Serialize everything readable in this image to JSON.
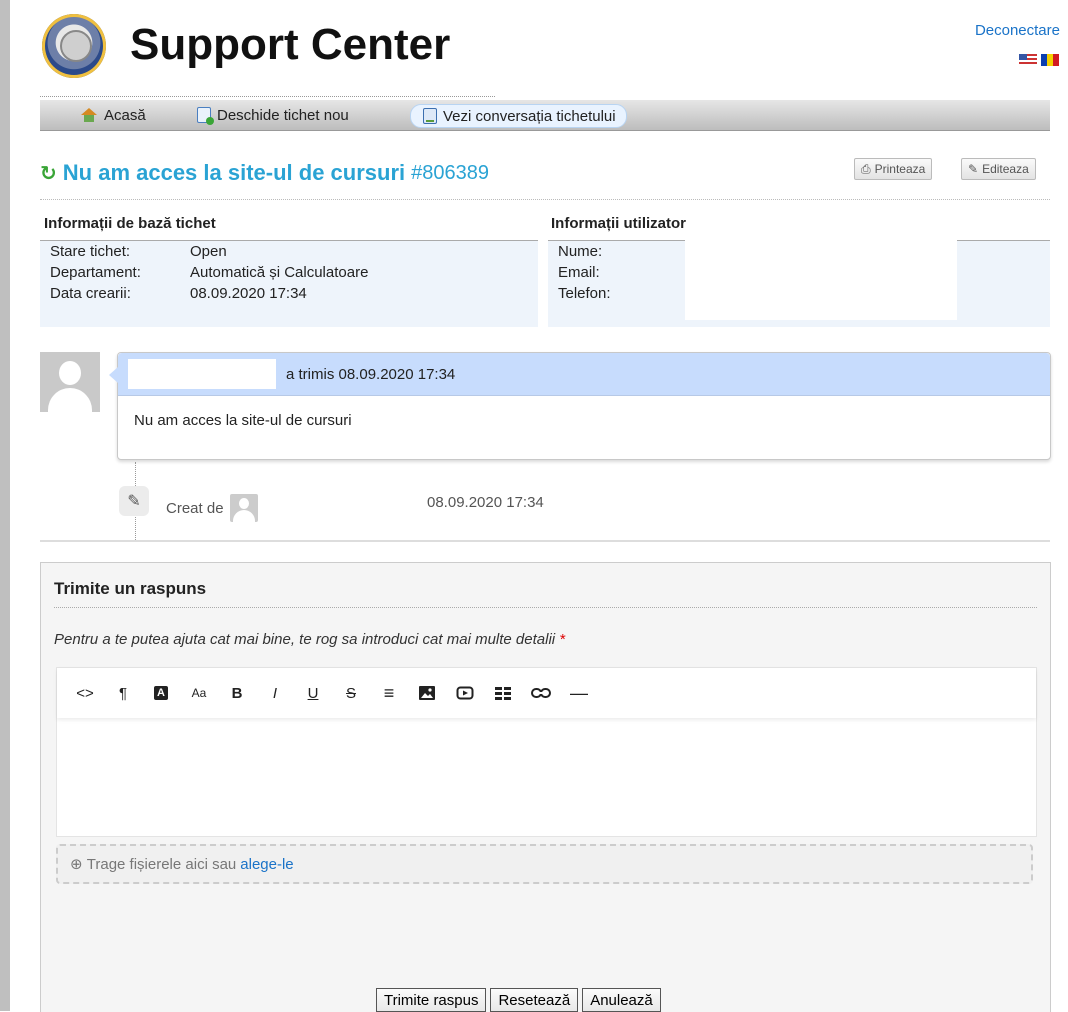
{
  "header": {
    "app_title": "Support Center",
    "logout_label": "Deconectare",
    "languages": [
      "english-flag-icon",
      "romanian-flag-icon"
    ]
  },
  "nav": {
    "home": "Acasă",
    "new_ticket": "Deschide tichet nou",
    "view_ticket": "Vezi conversația tichetului",
    "active": "view_ticket"
  },
  "ticket": {
    "subject": "Nu am acces la site-ul de cursuri",
    "number": "#806389",
    "print_label": "Printeaza",
    "edit_label": "Editeaza"
  },
  "basic_info": {
    "heading": "Informații de bază tichet",
    "rows": [
      {
        "key": "Stare tichet:",
        "value": "Open"
      },
      {
        "key": "Departament:",
        "value": "Automatică și Calculatoare"
      },
      {
        "key": "Data crearii:",
        "value": "08.09.2020 17:34"
      }
    ]
  },
  "user_info": {
    "heading": "Informații utilizator",
    "rows": [
      {
        "key": "Nume:",
        "value": ""
      },
      {
        "key": "Email:",
        "value": ""
      },
      {
        "key": "Telefon:",
        "value": ""
      }
    ]
  },
  "thread": {
    "message_header": "a trimis 08.09.2020 17:34",
    "message_body": "Nu am acces la site-ul de cursuri",
    "event_label": "Creat de",
    "event_date": "08.09.2020 17:34"
  },
  "reply": {
    "title": "Trimite un raspuns",
    "hint": "Pentru a te putea ajuta cat mai bine, te rog sa introduci cat mai multe detalii",
    "required_mark": "*",
    "toolbar": [
      "<>",
      "¶",
      "A",
      "Aa",
      "B",
      "I",
      "U",
      "S",
      "≡",
      "image",
      "video",
      "table",
      "link",
      "—"
    ],
    "drop_text": "Trage fișierele aici sau",
    "drop_link": "alege-le",
    "submit_label": "Trimite raspus",
    "reset_label": "Resetează",
    "cancel_label": "Anulează"
  }
}
